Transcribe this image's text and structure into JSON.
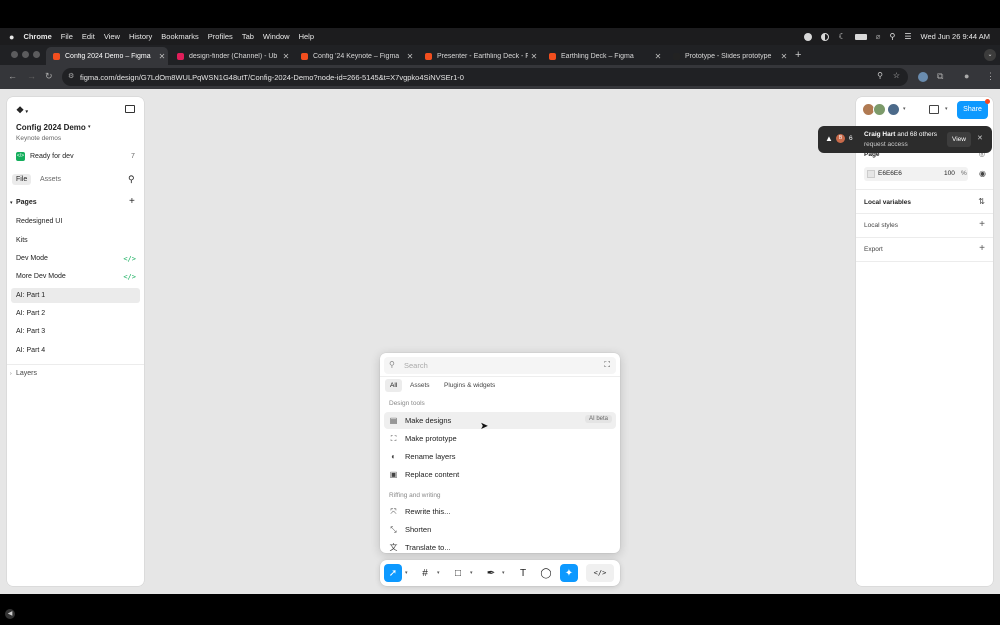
{
  "menubar": {
    "app": "Chrome",
    "items": [
      "File",
      "Edit",
      "View",
      "History",
      "Bookmarks",
      "Profiles",
      "Tab",
      "Window",
      "Help"
    ],
    "datetime": "Wed Jun 26  9:44 AM"
  },
  "tabs": [
    {
      "label": "Config 2024 Demo – Figma",
      "active": true,
      "favicon_color": "#f24e1e"
    },
    {
      "label": "design-finder (Channel) - Ub",
      "active": false,
      "favicon_color": "#e01e5a"
    },
    {
      "label": "Config '24 Keynote – Figma",
      "active": false,
      "favicon_color": "#f24e1e"
    },
    {
      "label": "Presenter - Earthling Deck - F",
      "active": false,
      "favicon_color": "#f24e1e"
    },
    {
      "label": "Earthling Deck – Figma",
      "active": false,
      "favicon_color": "#f24e1e"
    },
    {
      "label": "Prototype - Slides prototype",
      "active": false,
      "favicon_color": "#222222"
    }
  ],
  "address": {
    "url": "figma.com/design/G7LdOm8WULPqWSN1G48utT/Config-2024-Demo?node-id=266-5145&t=X7vgpko4SiNVSEr1-0"
  },
  "left_panel": {
    "file_name": "Config 2024 Demo",
    "project": "Keynote demos",
    "ready_for_dev": "Ready for dev",
    "ready_count": "7",
    "tab_file": "File",
    "tab_assets": "Assets",
    "pages_header": "Pages",
    "pages": [
      {
        "label": "Redesigned UI",
        "dev": false,
        "selected": false
      },
      {
        "label": "Kits",
        "dev": false,
        "selected": false
      },
      {
        "label": "Dev Mode",
        "dev": true,
        "selected": false
      },
      {
        "label": "More Dev Mode",
        "dev": true,
        "selected": false
      },
      {
        "label": "AI: Part 1",
        "dev": false,
        "selected": true
      },
      {
        "label": "AI: Part 2",
        "dev": false,
        "selected": false
      },
      {
        "label": "AI: Part 3",
        "dev": false,
        "selected": false
      },
      {
        "label": "AI: Part 4",
        "dev": false,
        "selected": false
      }
    ],
    "layers_header": "Layers"
  },
  "right_panel": {
    "share_label": "Share",
    "page_label": "Page",
    "page_color": "E6E6E6",
    "page_opacity": "100",
    "opacity_unit": "%",
    "local_variables": "Local variables",
    "local_styles": "Local styles",
    "export": "Export"
  },
  "toast": {
    "count": "6",
    "name": "Craig Hart",
    "message_rest": " and 68 others",
    "line2": "request access",
    "view_label": "View"
  },
  "palette": {
    "search_placeholder": "Search",
    "tabs": [
      "All",
      "Assets",
      "Plugins & widgets"
    ],
    "section1": "Design tools",
    "items1": [
      {
        "label": "Make designs",
        "badge": "AI beta",
        "icon": "make-designs-icon",
        "glyph": "▤"
      },
      {
        "label": "Make prototype",
        "badge": "",
        "icon": "prototype-icon",
        "glyph": "⛶"
      },
      {
        "label": "Rename layers",
        "badge": "",
        "icon": "rename-icon",
        "glyph": "◐"
      },
      {
        "label": "Replace content",
        "badge": "",
        "icon": "replace-icon",
        "glyph": "▣"
      }
    ],
    "section2": "Riffing and writing",
    "items2": [
      {
        "label": "Rewrite this...",
        "icon": "rewrite-icon",
        "glyph": "⤧"
      },
      {
        "label": "Shorten",
        "icon": "shorten-icon",
        "glyph": "⤡"
      },
      {
        "label": "Translate to...",
        "icon": "translate-icon",
        "glyph": "文"
      }
    ]
  },
  "colors": {
    "canvas": "#e6e6e6",
    "accent": "#0d99ff",
    "dev_green": "#14ae5c"
  }
}
